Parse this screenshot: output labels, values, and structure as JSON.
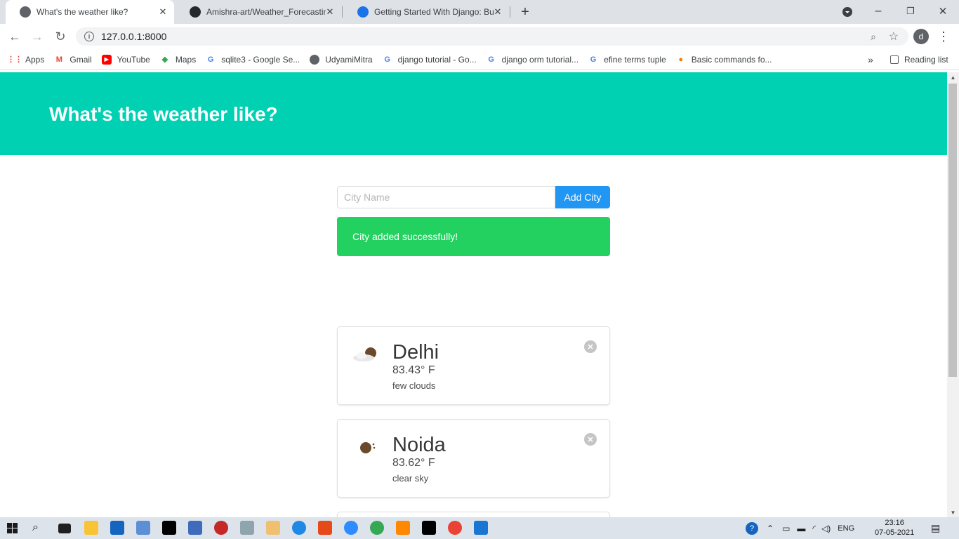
{
  "browser": {
    "tabs": [
      {
        "title": "What's the weather like?",
        "active": true
      },
      {
        "title": "Amishra-art/Weather_Forecasting",
        "active": false
      },
      {
        "title": "Getting Started With Django: Buil",
        "active": false
      }
    ],
    "url": "127.0.0.1:8000",
    "profile_initial": "d",
    "bookmarks": [
      {
        "label": "Apps",
        "icon": "apps-grid-icon"
      },
      {
        "label": "Gmail",
        "icon": "gmail-icon"
      },
      {
        "label": "YouTube",
        "icon": "youtube-icon"
      },
      {
        "label": "Maps",
        "icon": "maps-icon"
      },
      {
        "label": "sqlite3 - Google Se...",
        "icon": "google-icon"
      },
      {
        "label": "UdyamiMitra",
        "icon": "globe-icon"
      },
      {
        "label": "django tutorial - Go...",
        "icon": "google-icon"
      },
      {
        "label": "django orm tutorial...",
        "icon": "google-icon"
      },
      {
        "label": "efine terms tuple",
        "icon": "google-icon"
      },
      {
        "label": "Basic commands fo...",
        "icon": "bookmark-icon"
      }
    ],
    "overflow_label": "»",
    "reading_list_label": "Reading list"
  },
  "page": {
    "title": "What's the weather like?",
    "form": {
      "placeholder": "City Name",
      "button_label": "Add City"
    },
    "notice": "City added successfully!",
    "cards": [
      {
        "city": "Delhi",
        "temperature": "83.43° F",
        "description": "few clouds",
        "icon": "few-clouds-icon"
      },
      {
        "city": "Noida",
        "temperature": "83.62° F",
        "description": "clear sky",
        "icon": "clear-sky-icon"
      }
    ]
  },
  "taskbar": {
    "language": "ENG",
    "time": "23:16",
    "date": "07-05-2021"
  },
  "colors": {
    "hero": "#00d1b2",
    "button": "#2196f3",
    "notice": "#23d160"
  }
}
